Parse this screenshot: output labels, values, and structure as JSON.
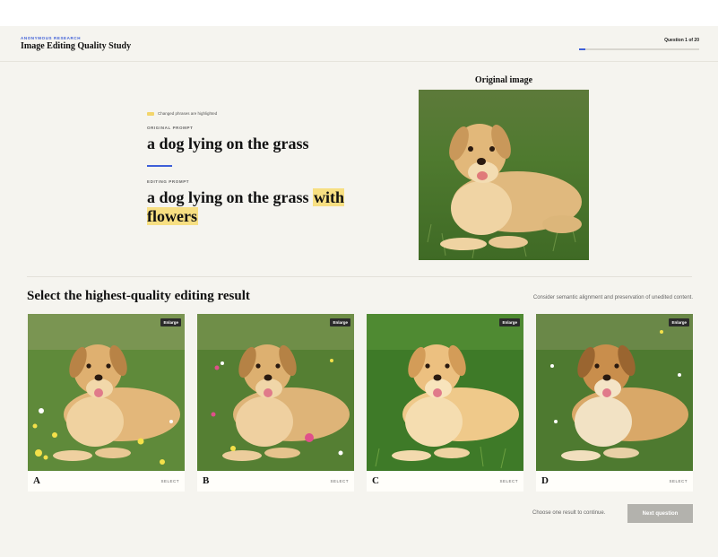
{
  "header": {
    "eyebrow": "Anonymous Research",
    "title": "Image Editing Quality Study",
    "question_counter": "Question 1 of 20",
    "progress": 0.05
  },
  "prompts": {
    "legend": "Changed phrases are highlighted",
    "original_label": "Original prompt",
    "original_text": "a dog lying on the grass",
    "editing_label": "Editing prompt",
    "editing_text_base": "a dog lying on the grass",
    "editing_text_changed": "with flowers"
  },
  "original_image": {
    "caption": "Original image"
  },
  "selection": {
    "heading": "Select the highest-quality editing result",
    "hint": "Consider semantic alignment and preservation of unedited content.",
    "enlarge_label": "Enlarge",
    "select_label": "SELECT",
    "options": [
      {
        "letter": "A"
      },
      {
        "letter": "B"
      },
      {
        "letter": "C"
      },
      {
        "letter": "D"
      }
    ]
  },
  "footer": {
    "hint": "Choose one result to continue.",
    "next_label": "Next question"
  },
  "colors": {
    "accent": "#3e5fd8",
    "highlight": "#f7df82",
    "background": "#f5f4ef",
    "button_disabled": "#b3b2ad"
  }
}
